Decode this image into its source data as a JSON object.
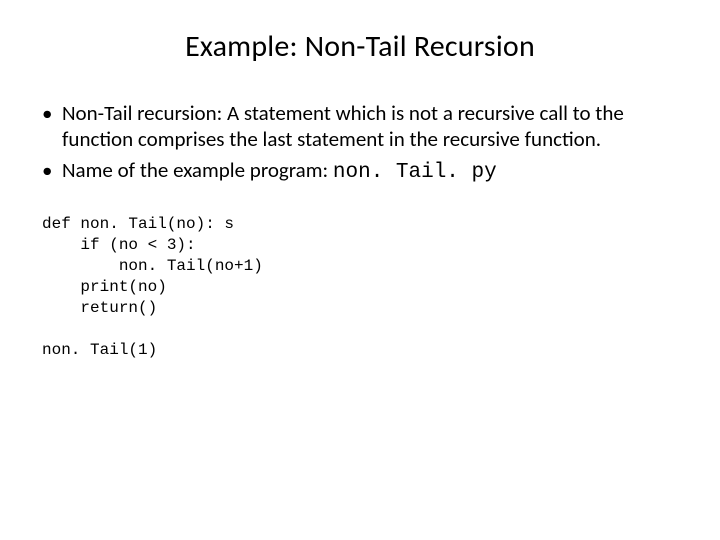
{
  "title": "Example: Non-Tail Recursion",
  "bullets": [
    {
      "text_before": "Non-Tail recursion: A statement which is not a recursive call to the function comprises the last statement in the recursive function.",
      "mono": "",
      "text_after": ""
    },
    {
      "text_before": "Name of the example program: ",
      "mono": "non. Tail. py",
      "text_after": ""
    }
  ],
  "code": "def non. Tail(no): s\n    if (no < 3):\n        non. Tail(no+1)\n    print(no)\n    return()\n\nnon. Tail(1)"
}
